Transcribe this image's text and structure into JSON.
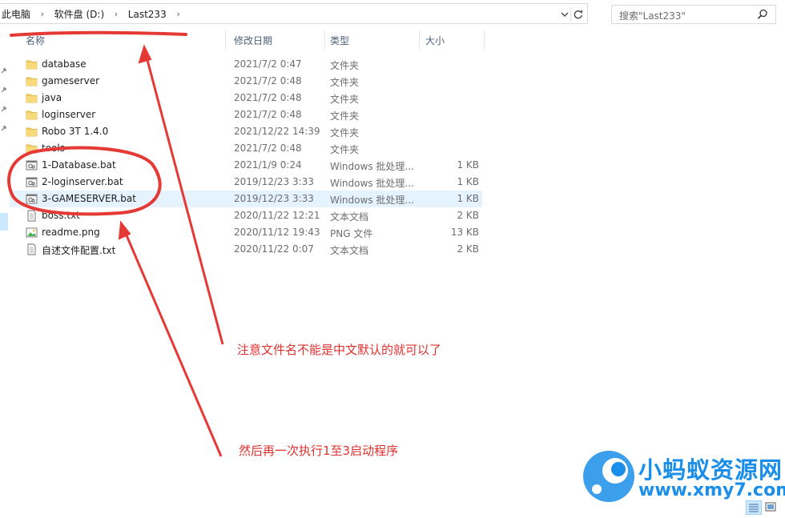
{
  "address_bar": {
    "crumbs": [
      "此电脑",
      "软件盘 (D:)",
      "Last233"
    ]
  },
  "search": {
    "placeholder": "搜索\"Last233\""
  },
  "columns": {
    "name": "名称",
    "date": "修改日期",
    "type": "类型",
    "size": "大小"
  },
  "files": [
    {
      "name": "database",
      "date": "2021/7/2 0:47",
      "type": "文件夹",
      "size": "",
      "icon": "folder-icon"
    },
    {
      "name": "gameserver",
      "date": "2021/7/2 0:48",
      "type": "文件夹",
      "size": "",
      "icon": "folder-icon"
    },
    {
      "name": "java",
      "date": "2021/7/2 0:48",
      "type": "文件夹",
      "size": "",
      "icon": "folder-icon"
    },
    {
      "name": "loginserver",
      "date": "2021/7/2 0:48",
      "type": "文件夹",
      "size": "",
      "icon": "folder-icon"
    },
    {
      "name": "Robo 3T 1.4.0",
      "date": "2021/12/22 14:39",
      "type": "文件夹",
      "size": "",
      "icon": "folder-icon"
    },
    {
      "name": "tools",
      "date": "2021/7/2 0:48",
      "type": "文件夹",
      "size": "",
      "icon": "folder-icon"
    },
    {
      "name": "1-Database.bat",
      "date": "2021/1/9 0:24",
      "type": "Windows 批处理...",
      "size": "1 KB",
      "icon": "batch-file-icon"
    },
    {
      "name": "2-loginserver.bat",
      "date": "2019/12/23 3:33",
      "type": "Windows 批处理...",
      "size": "1 KB",
      "icon": "batch-file-icon"
    },
    {
      "name": "3-GAMESERVER.bat",
      "date": "2019/12/23 3:33",
      "type": "Windows 批处理...",
      "size": "1 KB",
      "icon": "batch-file-icon"
    },
    {
      "name": "boss.txt",
      "date": "2020/11/22 12:21",
      "type": "文本文档",
      "size": "2 KB",
      "icon": "text-file-icon"
    },
    {
      "name": "readme.png",
      "date": "2020/11/12 19:43",
      "type": "PNG 文件",
      "size": "13 KB",
      "icon": "image-file-icon"
    },
    {
      "name": "自述文件配置.txt",
      "date": "2020/11/22 0:07",
      "type": "文本文档",
      "size": "2 KB",
      "icon": "text-file-icon"
    }
  ],
  "selected_index": 8,
  "annotations": {
    "note1": "注意文件名不能是中文默认的就可以了",
    "note2": "然后再一次执行1至3启动程序",
    "color": "#e0302e"
  },
  "watermark": {
    "name": "小蚂蚁资源网",
    "url": "www.xmy7.com",
    "color": "#1a8ee8"
  },
  "colors": {
    "selection": "#e5f3ff",
    "folder": "#f4cd5d",
    "header_text": "#4c607a"
  }
}
